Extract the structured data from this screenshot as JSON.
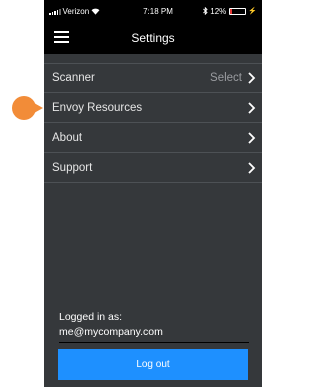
{
  "status_bar": {
    "carrier": "Verizon",
    "time": "7:18 PM",
    "battery_percent": "12%",
    "battery_level": 0.12,
    "icons": [
      "signal-icon",
      "wifi-icon",
      "bluetooth-icon",
      "battery-icon",
      "charging-icon"
    ]
  },
  "navbar": {
    "title": "Settings",
    "menu_icon": "hamburger-menu-icon"
  },
  "settings": {
    "items": [
      {
        "label": "Scanner",
        "value": "Select",
        "icon": "chevron-right-icon"
      },
      {
        "label": "Envoy Resources",
        "value": "",
        "icon": "chevron-right-icon"
      },
      {
        "label": "About",
        "value": "",
        "icon": "chevron-right-icon"
      },
      {
        "label": "Support",
        "value": "",
        "icon": "chevron-right-icon"
      }
    ]
  },
  "account": {
    "logged_in_label": "Logged in as:",
    "email": "me@mycompany.com",
    "logout_label": "Log out"
  },
  "colors": {
    "background": "#35383b",
    "bar": "#000000",
    "accent": "#1e90ff",
    "callout": "#f28c38",
    "battery_low": "#e53935"
  }
}
